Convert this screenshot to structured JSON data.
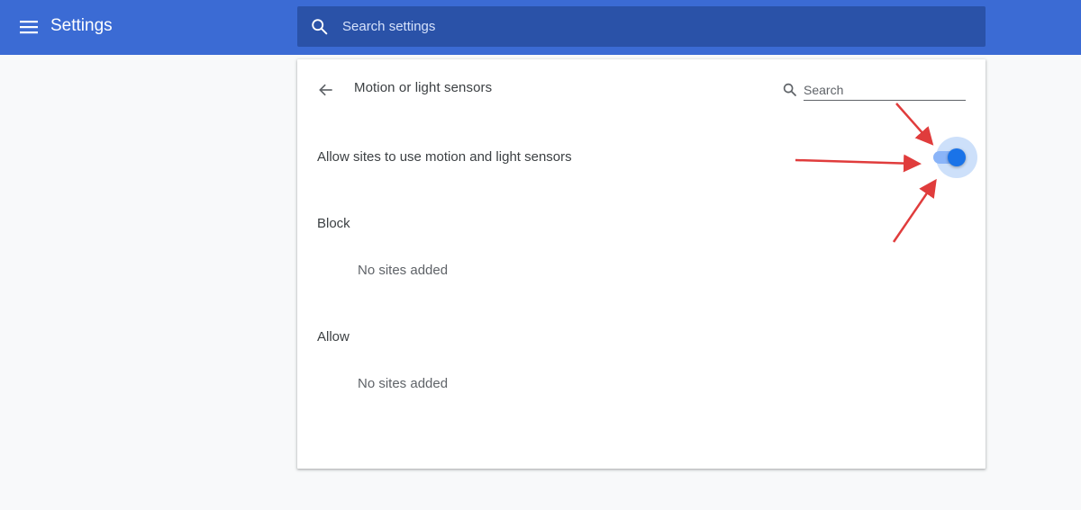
{
  "header": {
    "title": "Settings",
    "search_placeholder": "Search settings"
  },
  "page": {
    "title": "Motion or light sensors",
    "search_placeholder": "Search"
  },
  "setting": {
    "label": "Allow sites to use motion and light sensors",
    "enabled": true
  },
  "sections": [
    {
      "heading": "Block",
      "empty_text": "No sites added"
    },
    {
      "heading": "Allow",
      "empty_text": "No sites added"
    }
  ],
  "colors": {
    "header_bg": "#3b6bd4",
    "search_bg": "#2a52a8",
    "toggle_on": "#1a73e8",
    "annotation_arrow": "#e03c3c"
  },
  "icons": {
    "menu": "hamburger-menu-icon",
    "search": "search-icon",
    "back": "arrow-back-icon"
  }
}
